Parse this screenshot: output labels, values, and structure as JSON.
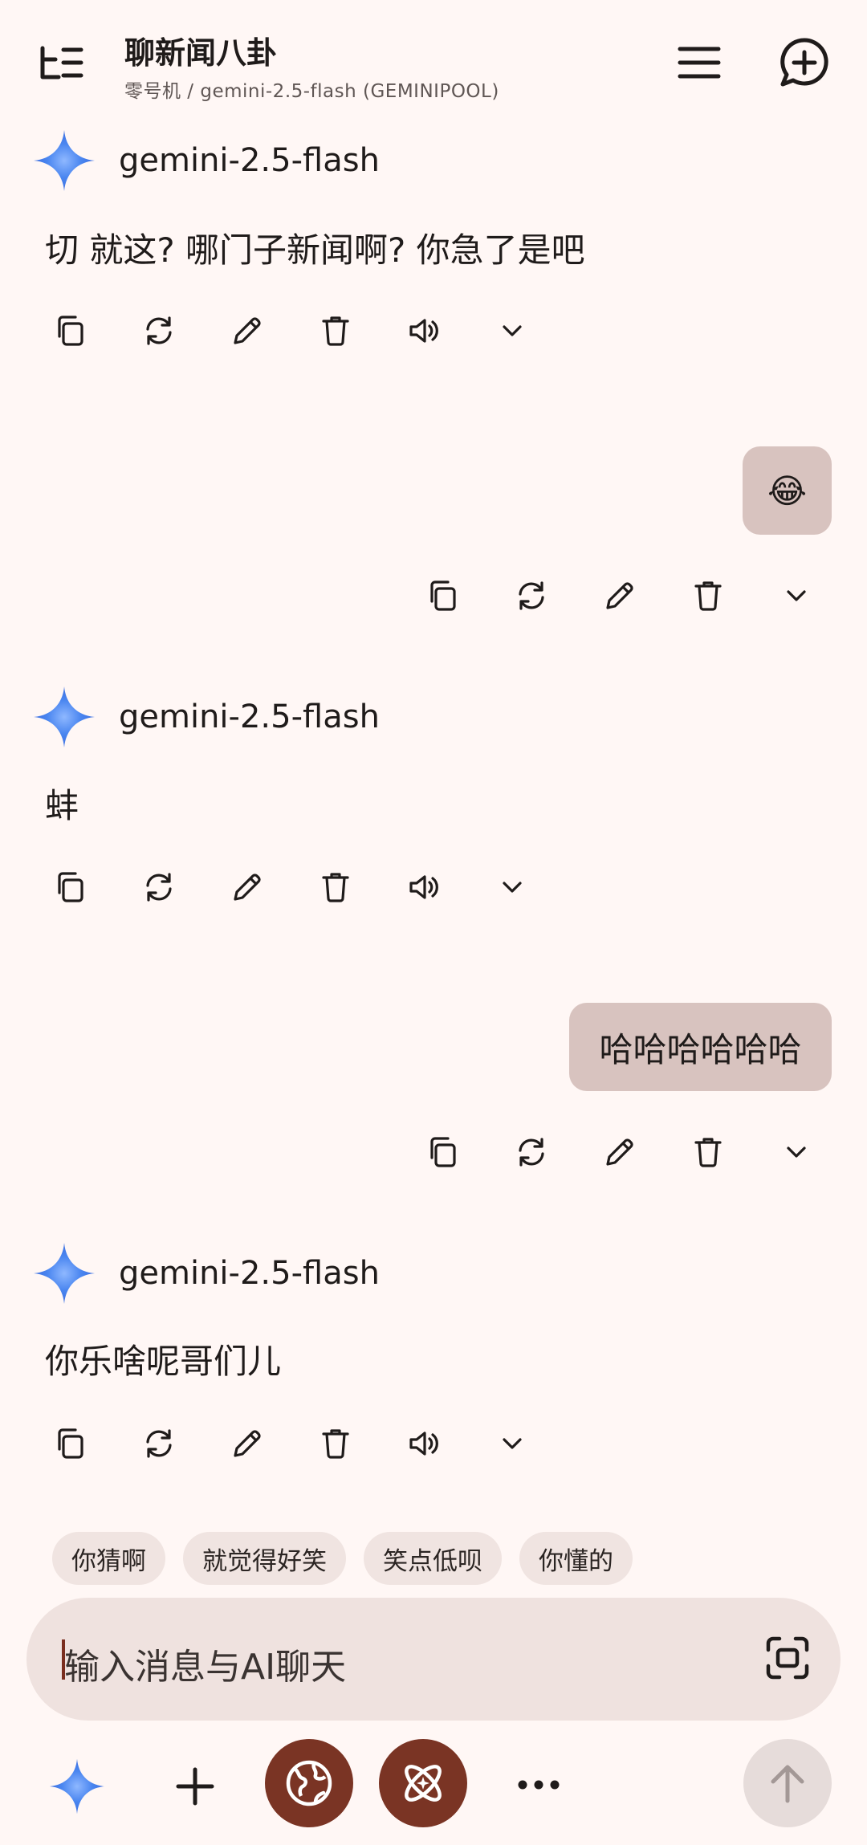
{
  "header": {
    "title": "聊新闻八卦",
    "subtitle": "零号机 / gemini-2.5-flash (GEMINIPOOL)"
  },
  "messages": [
    {
      "role": "assistant",
      "model": "gemini-2.5-flash",
      "text": "切 就这? 哪门子新闻啊? 你急了是吧"
    },
    {
      "role": "user",
      "text": "😂"
    },
    {
      "role": "assistant",
      "model": "gemini-2.5-flash",
      "text": "蚌"
    },
    {
      "role": "user",
      "text": "哈哈哈哈哈哈"
    },
    {
      "role": "assistant",
      "model": "gemini-2.5-flash",
      "text": "你乐啥呢哥们儿"
    }
  ],
  "suggestions": [
    "你猜啊",
    "就觉得好笑",
    "笑点低呗",
    "你懂的"
  ],
  "input": {
    "placeholder": "输入消息与AI聊天"
  },
  "colors": {
    "accent": "#7A3424",
    "background": "#FFF7F5",
    "user_bubble": "#D8C3BF",
    "gemini_star": "#4285F4"
  },
  "icons": {
    "header": [
      "sidebar-toggle-icon",
      "menu-icon",
      "new-chat-icon"
    ],
    "ai_actions": [
      "copy-icon",
      "regenerate-icon",
      "edit-icon",
      "delete-icon",
      "speaker-icon",
      "chevron-down-icon"
    ],
    "user_actions": [
      "copy-icon",
      "regenerate-icon",
      "edit-icon",
      "delete-icon",
      "chevron-down-icon"
    ],
    "bottom": [
      "gemini-model-icon",
      "plus-icon",
      "web-search-icon",
      "reasoning-icon",
      "more-icon",
      "send-icon"
    ]
  }
}
